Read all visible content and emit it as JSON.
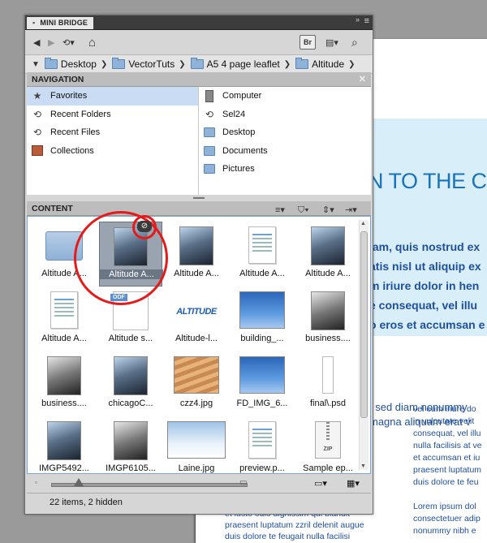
{
  "document": {
    "heading": "N TO THE C",
    "lines_big": [
      "iam, quis nostrud ex",
      "atis nisl ut aliquip ex",
      "m iriure dolor in hen",
      "e consequat, vel illu",
      "o eros et accumsan e"
    ],
    "lines_mid": [
      ", sed diam nonummy",
      "magna aliquam erat v"
    ],
    "col_right": [
      "vel eum iriure do",
      "in vulputate velit",
      "consequat, vel illu",
      "nulla facilisis at ve",
      "et accumsan et iu",
      "praesent luptatum",
      "duis dolore te feu",
      "",
      "Lorem ipsum dol",
      "consectetuer adip",
      "nonummy nibh e"
    ],
    "col_left": [
      "et iusto odio dignissim qui blandit",
      "praesent luptatum zzril delenit augue",
      "duis dolore te feugait nulla facilisi"
    ]
  },
  "panel": {
    "title": "MINI BRIDGE",
    "menu_icon": "panel-menu-icon",
    "toolbar": {
      "bridge_label": "Br"
    },
    "breadcrumbs": [
      "Desktop",
      "VectorTuts",
      "A5 4 page leaflet",
      "Altitude"
    ],
    "navigation": {
      "header": "NAVIGATION",
      "left": [
        {
          "label": "Favorites",
          "icon": "star-icon",
          "selected": true
        },
        {
          "label": "Recent Folders",
          "icon": "recent-folders-icon"
        },
        {
          "label": "Recent Files",
          "icon": "recent-files-icon"
        },
        {
          "label": "Collections",
          "icon": "collections-icon"
        }
      ],
      "right": [
        {
          "label": "Computer",
          "icon": "computer-icon"
        },
        {
          "label": "Sel24",
          "icon": "recent-icon"
        },
        {
          "label": "Desktop",
          "icon": "folder-icon"
        },
        {
          "label": "Documents",
          "icon": "folder-icon"
        },
        {
          "label": "Pictures",
          "icon": "folder-icon"
        }
      ]
    },
    "content": {
      "header": "CONTENT",
      "items": [
        {
          "label": "Altitude A...",
          "kind": "folder"
        },
        {
          "label": "Altitude A...",
          "kind": "photo",
          "selected": true
        },
        {
          "label": "Altitude A...",
          "kind": "photo"
        },
        {
          "label": "Altitude A...",
          "kind": "page"
        },
        {
          "label": "Altitude A...",
          "kind": "photo"
        },
        {
          "label": "Altitude A...",
          "kind": "page"
        },
        {
          "label": "Altitude s...",
          "kind": "odf"
        },
        {
          "label": "Altitude-l...",
          "kind": "logo",
          "logo_text": "ALTITUDE"
        },
        {
          "label": "building_...",
          "kind": "sky"
        },
        {
          "label": "business....",
          "kind": "photo-bw"
        },
        {
          "label": "business....",
          "kind": "photo-bw"
        },
        {
          "label": "chicagoC...",
          "kind": "photo"
        },
        {
          "label": "czz4.jpg",
          "kind": "stair"
        },
        {
          "label": "FD_IMG_6...",
          "kind": "sky"
        },
        {
          "label": "final\\.psd",
          "kind": "psd"
        },
        {
          "label": "IMGP5492...",
          "kind": "photo"
        },
        {
          "label": "IMGP6105...",
          "kind": "photo-bw"
        },
        {
          "label": "Laine.jpg",
          "kind": "snow"
        },
        {
          "label": "preview.p...",
          "kind": "page"
        },
        {
          "label": "Sample ep...",
          "kind": "zip",
          "tag": "ZIP"
        }
      ],
      "odf_tag": "ODF"
    },
    "status": "22 items, 2 hidden"
  },
  "colors": {
    "accent": "#e51a1a",
    "selection": "#c9dcf4",
    "doc_text": "#1f4f9e"
  }
}
